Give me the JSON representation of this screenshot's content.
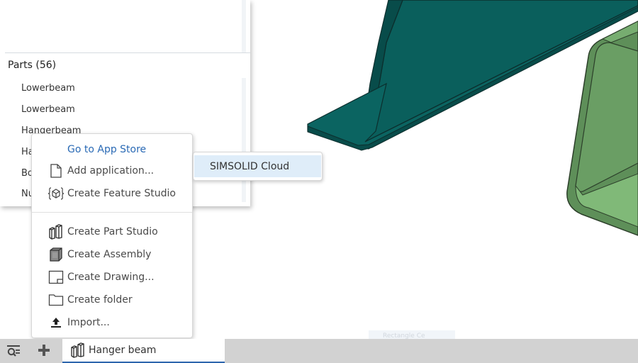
{
  "viewport": {
    "colors": {
      "beam_teal": "#0a5f5c",
      "beam_teal_dark": "#084c4a",
      "beam_edge": "#0c2e2d",
      "channel_green": "#6a9e64",
      "channel_green_light": "#80b978",
      "channel_edge": "#2c3f2a"
    }
  },
  "parts_panel": {
    "header": "Parts (56)",
    "items": [
      "Lowerbeam",
      "Lowerbeam",
      "Hangerbeam",
      "Ha",
      "Bo",
      "Nu"
    ]
  },
  "context_menu": {
    "link_item": "Go to App Store",
    "items_top": [
      {
        "label": "Add application...",
        "icon": "file-icon"
      },
      {
        "label": "Create Feature Studio",
        "icon": "feature-studio-icon"
      }
    ],
    "items_bottom": [
      {
        "label": "Create Part Studio",
        "icon": "part-studio-icon"
      },
      {
        "label": "Create Assembly",
        "icon": "assembly-icon"
      },
      {
        "label": "Create Drawing...",
        "icon": "drawing-icon"
      },
      {
        "label": "Create folder",
        "icon": "folder-icon"
      },
      {
        "label": "Import...",
        "icon": "import-icon"
      }
    ]
  },
  "submenu": {
    "items": [
      "SIMSOLID Cloud"
    ]
  },
  "ghost_tooltip": "Rectangle Ce",
  "tabbar": {
    "active_tab": "Hanger beam",
    "accent": "#2d66ad"
  }
}
